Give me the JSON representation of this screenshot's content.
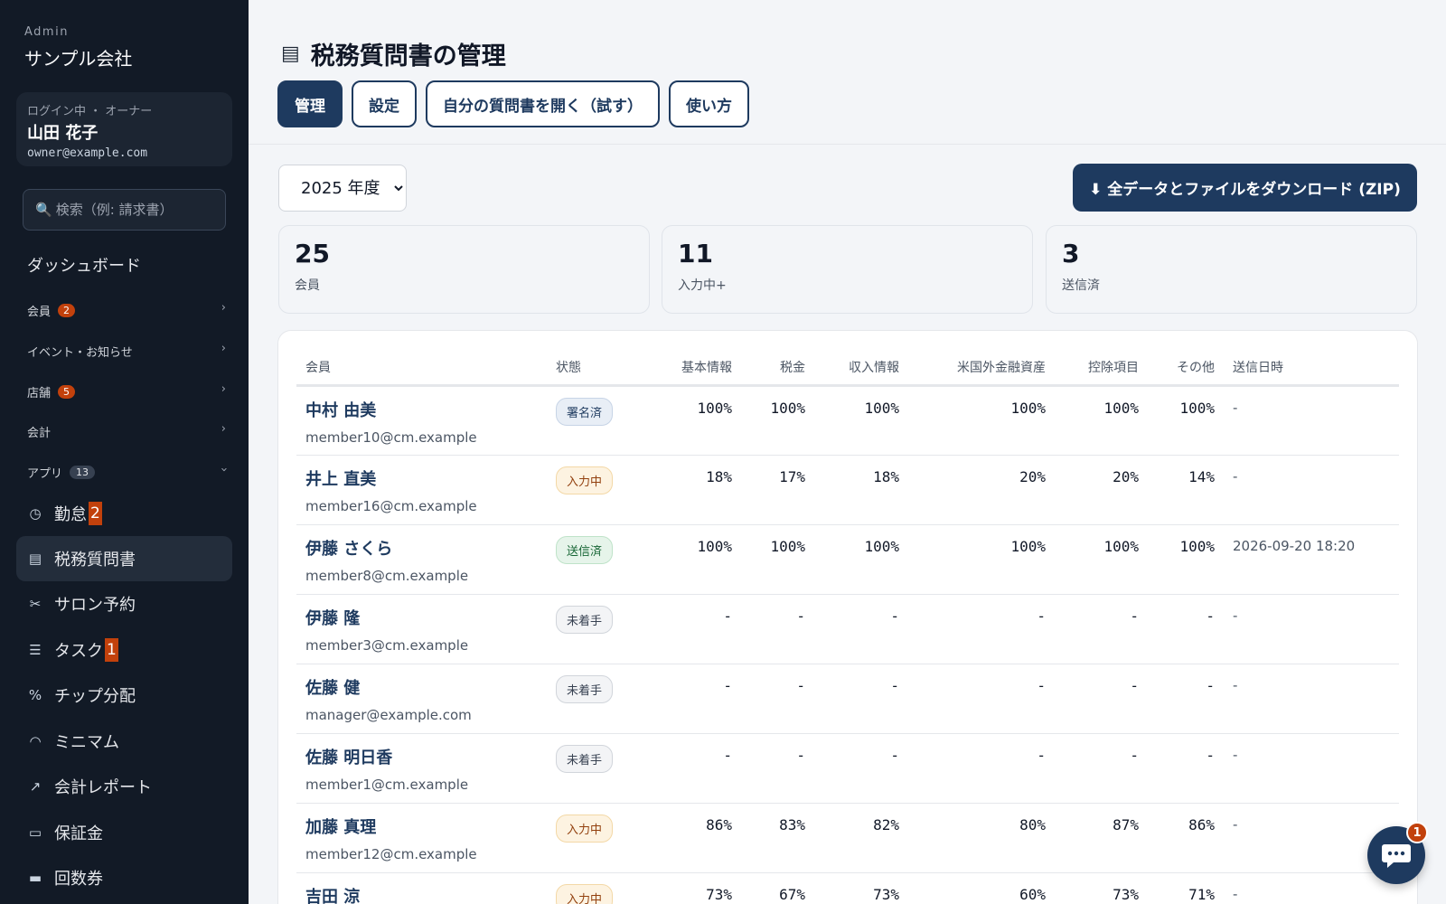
{
  "sidebar": {
    "admin_label": "Admin",
    "company": "サンプル会社",
    "user": {
      "role": "ログイン中 ・ オーナー",
      "name": "山田 花子",
      "email": "owner@example.com"
    },
    "search_placeholder": "検索（例: 請求書）",
    "dashboard": "ダッシュボード",
    "sections": [
      {
        "label": "会員",
        "badge": "2"
      },
      {
        "label": "イベント・お知らせ",
        "badge": ""
      },
      {
        "label": "店舗",
        "badge": "5"
      },
      {
        "label": "会計",
        "badge": ""
      },
      {
        "label": "アプリ",
        "badge": "13"
      }
    ],
    "apps": [
      {
        "label": "勤怠",
        "badge": "2",
        "icon": "clock-icon"
      },
      {
        "label": "税務質問書",
        "badge": "",
        "icon": "document-icon"
      },
      {
        "label": "サロン予約",
        "badge": "",
        "icon": "scissors-icon"
      },
      {
        "label": "タスク",
        "badge": "1",
        "icon": "checklist-icon"
      },
      {
        "label": "チップ分配",
        "badge": "",
        "icon": "percent-icon"
      },
      {
        "label": "ミニマム",
        "badge": "",
        "icon": "gauge-icon"
      },
      {
        "label": "会計レポート",
        "badge": "",
        "icon": "chart-icon"
      },
      {
        "label": "保証金",
        "badge": "",
        "icon": "receipt-icon"
      },
      {
        "label": "回数券",
        "badge": "",
        "icon": "ticket-icon"
      }
    ]
  },
  "header": {
    "title": "税務質問書の管理",
    "tabs": [
      "管理",
      "設定",
      "自分の質問書を開く（試す）",
      "使い方"
    ]
  },
  "toolbar": {
    "year": "2025 年度",
    "download_label": "⬇ 全データとファイルをダウンロード (ZIP)"
  },
  "stats": [
    {
      "value": "25",
      "label": "会員"
    },
    {
      "value": "11",
      "label": "入力中+"
    },
    {
      "value": "3",
      "label": "送信済"
    }
  ],
  "table": {
    "columns": [
      "会員",
      "状態",
      "基本情報",
      "税金",
      "収入情報",
      "米国外金融資産",
      "控除項目",
      "その他",
      "送信日時"
    ],
    "rows": [
      {
        "name": "中村 由美",
        "email": "member10@cm.example",
        "status": "署名済",
        "basic": "100%",
        "tax": "100%",
        "income": "100%",
        "foreign": "100%",
        "deduction": "100%",
        "other": "100%",
        "sent": "-"
      },
      {
        "name": "井上 直美",
        "email": "member16@cm.example",
        "status": "入力中",
        "basic": "18%",
        "tax": "17%",
        "income": "18%",
        "foreign": "20%",
        "deduction": "20%",
        "other": "14%",
        "sent": "-"
      },
      {
        "name": "伊藤 さくら",
        "email": "member8@cm.example",
        "status": "送信済",
        "basic": "100%",
        "tax": "100%",
        "income": "100%",
        "foreign": "100%",
        "deduction": "100%",
        "other": "100%",
        "sent": "2026-09-20 18:20"
      },
      {
        "name": "伊藤 隆",
        "email": "member3@cm.example",
        "status": "未着手",
        "basic": "-",
        "tax": "-",
        "income": "-",
        "foreign": "-",
        "deduction": "-",
        "other": "-",
        "sent": "-"
      },
      {
        "name": "佐藤 健",
        "email": "manager@example.com",
        "status": "未着手",
        "basic": "-",
        "tax": "-",
        "income": "-",
        "foreign": "-",
        "deduction": "-",
        "other": "-",
        "sent": "-"
      },
      {
        "name": "佐藤 明日香",
        "email": "member1@cm.example",
        "status": "未着手",
        "basic": "-",
        "tax": "-",
        "income": "-",
        "foreign": "-",
        "deduction": "-",
        "other": "-",
        "sent": "-"
      },
      {
        "name": "加藤 真理",
        "email": "member12@cm.example",
        "status": "入力中",
        "basic": "86%",
        "tax": "83%",
        "income": "82%",
        "foreign": "80%",
        "deduction": "87%",
        "other": "86%",
        "sent": "-"
      },
      {
        "name": "吉田 涼",
        "email": "",
        "status": "入力中",
        "basic": "73%",
        "tax": "67%",
        "income": "73%",
        "foreign": "60%",
        "deduction": "73%",
        "other": "71%",
        "sent": "-"
      }
    ]
  },
  "chat": {
    "badge": "1"
  },
  "colors": {
    "sidebar_bg": "#121a26",
    "accent": "#1e3a5f",
    "badge": "#c2410c"
  }
}
